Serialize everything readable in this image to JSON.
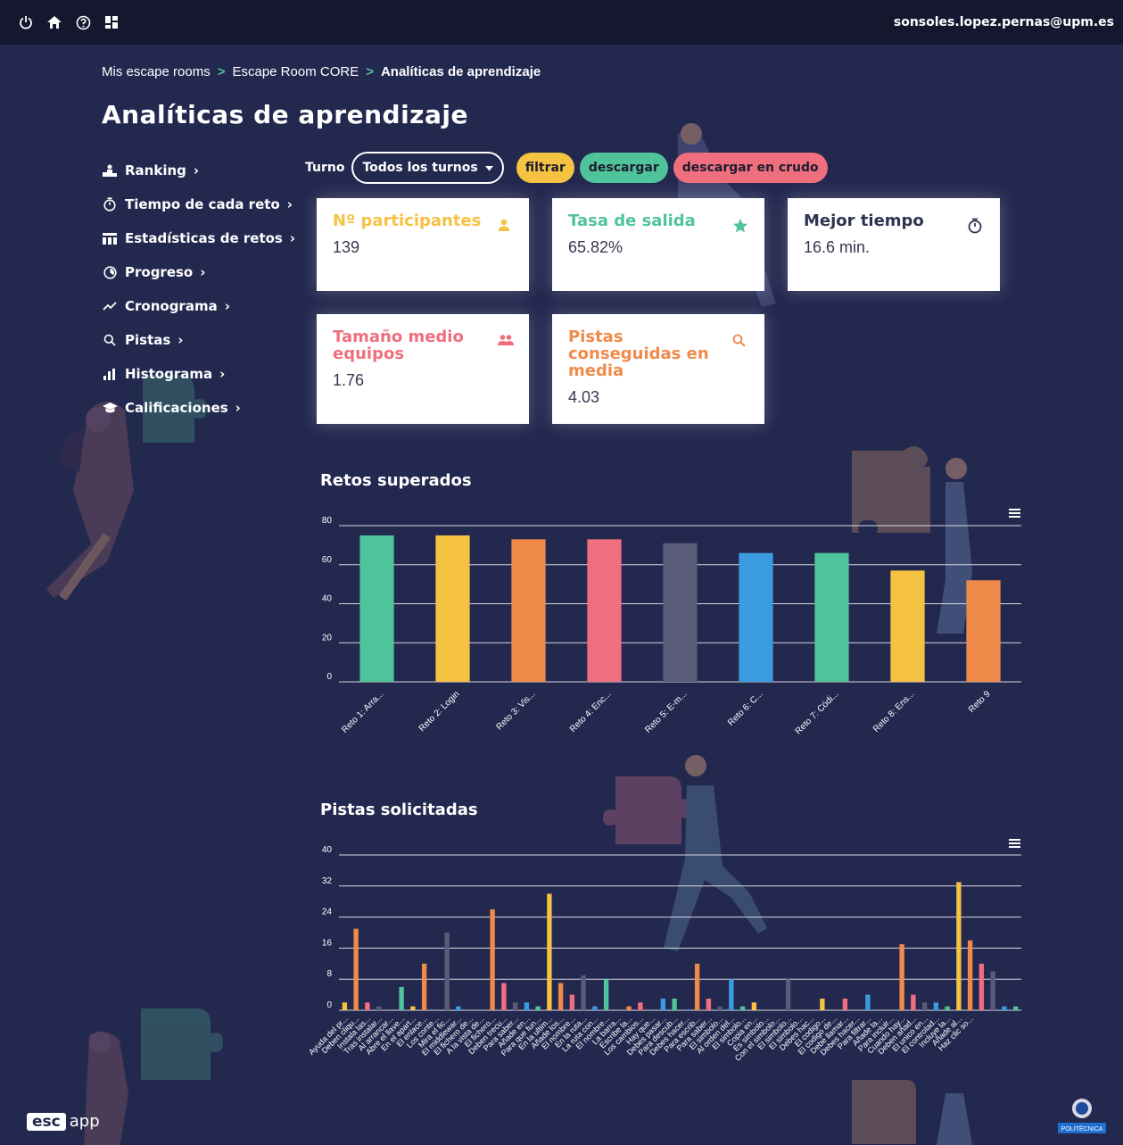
{
  "topbar": {
    "icons": [
      "power-icon",
      "home-icon",
      "help-icon",
      "dashboard-icon"
    ],
    "user_email": "sonsoles.lopez.pernas@upm.es"
  },
  "breadcrumb": {
    "items": [
      "Mis escape rooms",
      "Escape Room CORE",
      "Analíticas de aprendizaje"
    ],
    "separator": ">"
  },
  "page_title": "Analíticas de aprendizaje",
  "sidebar": {
    "items": [
      {
        "label": "Ranking",
        "icon": "podium-icon"
      },
      {
        "label": "Tiempo de cada reto",
        "icon": "stopwatch-icon"
      },
      {
        "label": "Estadísticas de retos",
        "icon": "table-icon"
      },
      {
        "label": "Progreso",
        "icon": "progress-icon"
      },
      {
        "label": "Cronograma",
        "icon": "trend-icon"
      },
      {
        "label": "Pistas",
        "icon": "search-icon"
      },
      {
        "label": "Histograma",
        "icon": "bar-chart-icon"
      },
      {
        "label": "Calificaciones",
        "icon": "graduation-cap-icon"
      }
    ],
    "chevron": "›"
  },
  "filters": {
    "turno_label": "Turno",
    "turno_value": "Todos los turnos",
    "filtrar": "filtrar",
    "descargar": "descargar",
    "descargar_crudo": "descargar en crudo"
  },
  "colors": {
    "background": "#23284f",
    "yellow": "#f5c242",
    "green": "#4fc39a",
    "red": "#ef6f7e",
    "orange": "#f08a4b",
    "dark": "#2f3350"
  },
  "cards": [
    {
      "title": "Nº participantes",
      "value": "139",
      "icon": "person-icon",
      "color": "#f5c242"
    },
    {
      "title": "Tasa de salida",
      "value": "65.82%",
      "icon": "star-icon",
      "color": "#4fc39a"
    },
    {
      "title": "Mejor tiempo",
      "value": "16.6 min.",
      "icon": "stopwatch-icon",
      "color": "#2f3350"
    },
    {
      "title": "Tamaño medio equipos",
      "value": "1.76",
      "icon": "group-icon",
      "color": "#ef6f7e"
    },
    {
      "title": "Pistas conseguidas en media",
      "value": "4.03",
      "icon": "search-icon",
      "color": "#f08a4b"
    }
  ],
  "chart_data": [
    {
      "type": "bar",
      "title": "Retos superados",
      "categories": [
        "Reto 1: Arra...",
        "Reto 2: Login",
        "Reto 3: Vis...",
        "Reto 4: Enc...",
        "Reto 5: E-m...",
        "Reto 6: C...",
        "Reto 7: Códi...",
        "Reto 8: Ens...",
        "Reto 9"
      ],
      "values": [
        75,
        75,
        73,
        73,
        71,
        66,
        66,
        57,
        52
      ],
      "colors": [
        "#4fc39a",
        "#f5c242",
        "#f08a4b",
        "#ef6f7e",
        "#5a5b78",
        "#3b9be0",
        "#4fc39a",
        "#f5c242",
        "#f08a4b"
      ],
      "yticks": [
        0,
        20,
        40,
        60,
        80
      ],
      "ylim": [
        0,
        80
      ],
      "grid": true,
      "menu_icon": "menu-icon"
    },
    {
      "type": "bar",
      "title": "Pistas solicitadas",
      "categories": [
        "Ayuda del pr...",
        "Deben cliqu...",
        "Instala las...",
        "Tras instalar...",
        "Al arrancar...",
        "Abre el llave...",
        "En el apart...",
        "El enlace...",
        "Los conte...",
        "Mira el fic...",
        "El middlewar...",
        "El fichero de...",
        "A la vista de...",
        "El fichero...",
        "Deben trecu...",
        "Para saber...",
        "Añade en...",
        "Para que fun...",
        "En la ultim...",
        "Añade los...",
        "El nombre...",
        "En la ruta...",
        "La ruta con...",
        "El nombre...",
        "La barra...",
        "Escribe la...",
        "Los cambios...",
        "Hay que...",
        "Debes pasar...",
        "Para descub...",
        "Debes hacer...",
        "Para escrib...",
        "Para saber...",
        "El simbolo...",
        "Al orden del...",
        "El simbolo...",
        "Copia en...",
        "Es simbolo...",
        "Con el simbolo...",
        "El simbolo...",
        "El simbolo...",
        "Debes hac...",
        "El codigo...",
        "El codigo de...",
        "Debe llamar...",
        "Debes hacer...",
        "Para filtrar...",
        "Añade la...",
        "Para incluir...",
        "Cuando hay...",
        "Deben añad...",
        "El unico en...",
        "El controlad...",
        "Incluye la...",
        "Añade al...",
        "Haz clic so..."
      ],
      "values": [
        2,
        21,
        2,
        1,
        0,
        6,
        1,
        12,
        0,
        20,
        1,
        0,
        0,
        26,
        7,
        2,
        2,
        1,
        30,
        7,
        4,
        9,
        1,
        8,
        0,
        1,
        2,
        0,
        3,
        3,
        0,
        12,
        3,
        1,
        8,
        1,
        2,
        0,
        0,
        8,
        0,
        0,
        3,
        0,
        3,
        0,
        4,
        0,
        0,
        17,
        4,
        2,
        2,
        1,
        33,
        18,
        12,
        10,
        1,
        1
      ],
      "colors": [
        "#f5c242",
        "#f08a4b",
        "#ef6f7e",
        "#5a5b78",
        "#3b9be0",
        "#4fc39a"
      ],
      "yticks": [
        0,
        8,
        16,
        24,
        32,
        40
      ],
      "ylim": [
        0,
        40
      ],
      "grid": true,
      "menu_icon": "menu-icon"
    }
  ],
  "logo": {
    "esc": "esc",
    "app": "app"
  },
  "footer_badge": "POLITÉCNICA"
}
